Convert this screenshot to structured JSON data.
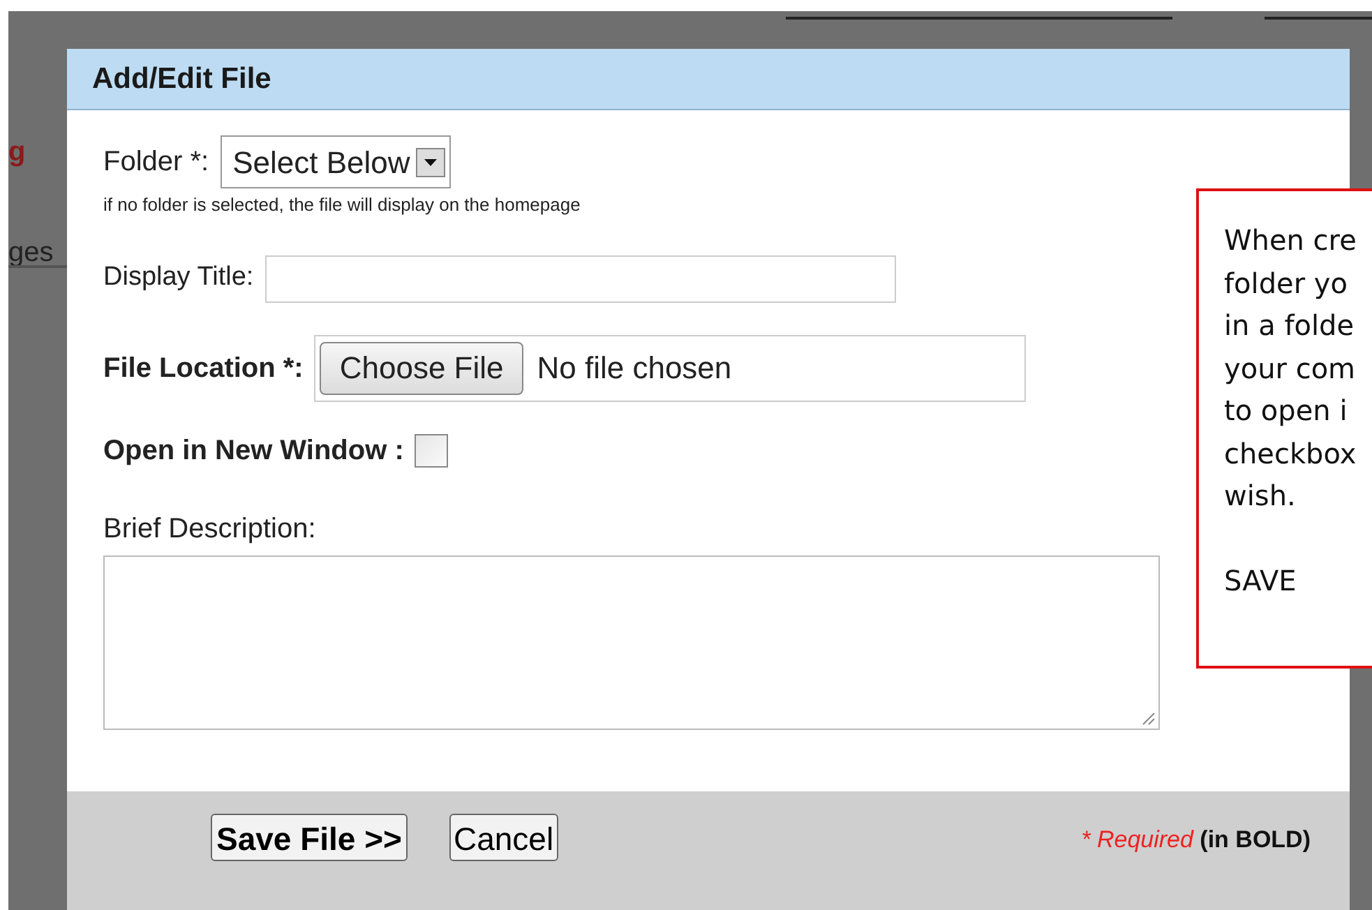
{
  "background_page": {
    "side_texts": [
      {
        "text": "g",
        "kind": "link"
      },
      {
        "text": "ges",
        "kind": "plain"
      }
    ]
  },
  "dialog": {
    "title": "Add/Edit File",
    "folder": {
      "label": "Folder *:",
      "value": "Select Below",
      "hint": "if no folder is selected, the file will display on the homepage"
    },
    "display_title": {
      "label": "Display Title:"
    },
    "file_location": {
      "label": "File Location *:",
      "button": "Choose File",
      "status": "No file chosen"
    },
    "open_in_new_window": {
      "label": "Open in New Window :",
      "checked": false
    },
    "brief_description": {
      "label": "Brief Description:"
    },
    "buttons": [
      "Save File >>",
      "Cancel"
    ],
    "required_note": {
      "mark": "* Required",
      "suffix": "(in BOLD)"
    }
  },
  "callout": {
    "paragraphs": [
      [
        "When cre",
        "folder yo",
        "in a folde",
        "your com",
        "to open i",
        "checkbox",
        "wish."
      ],
      [
        "SAVE"
      ]
    ]
  }
}
